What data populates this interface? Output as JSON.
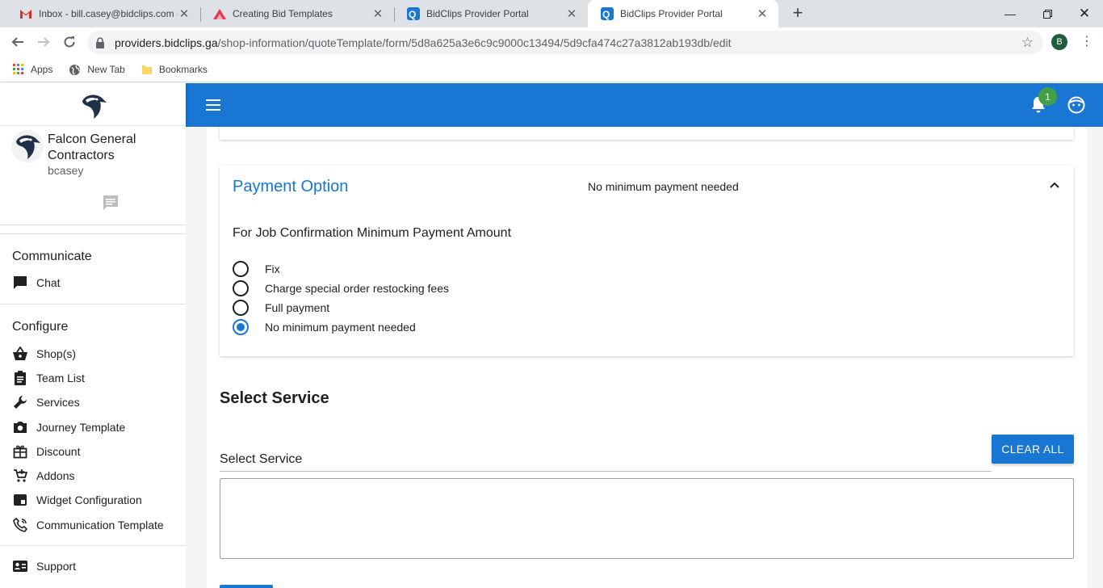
{
  "browser": {
    "tabs": [
      {
        "title": "Inbox - bill.casey@bidclips.com -",
        "icon": "gmail-icon",
        "active": false
      },
      {
        "title": "Creating Bid Templates",
        "icon": "mountain-icon",
        "active": false
      },
      {
        "title": "BidClips Provider Portal",
        "icon": "bidclips-icon",
        "active": false
      },
      {
        "title": "BidClips Provider Portal",
        "icon": "bidclips-icon",
        "active": true
      }
    ],
    "url_host": "providers.bidclips.ga",
    "url_path": "/shop-information/quoteTemplate/form/5d8a625a3e6c9c9000c13494/5d9cfa474c27a3812ab193db/edit",
    "profile_initial": "B",
    "bookmarks": [
      {
        "label": "Apps",
        "icon": "apps-grid-icon"
      },
      {
        "label": "New Tab",
        "icon": "globe-icon"
      },
      {
        "label": "Bookmarks",
        "icon": "folder-icon"
      }
    ]
  },
  "header": {
    "notification_count": "1",
    "color": "#1976d2"
  },
  "sidebar": {
    "org_name": "Falcon General Contractors",
    "username": "bcasey",
    "sections": [
      {
        "title": "Communicate",
        "items": [
          {
            "label": "Chat",
            "icon": "chat-icon"
          }
        ]
      },
      {
        "title": "Configure",
        "items": [
          {
            "label": "Shop(s)",
            "icon": "basket-icon"
          },
          {
            "label": "Team List",
            "icon": "clipboard-icon"
          },
          {
            "label": "Services",
            "icon": "wrench-icon"
          },
          {
            "label": "Journey Template",
            "icon": "camera-icon"
          },
          {
            "label": "Discount",
            "icon": "gift-icon"
          },
          {
            "label": "Addons",
            "icon": "cart-plus-icon"
          },
          {
            "label": "Widget Configuration",
            "icon": "widget-icon"
          },
          {
            "label": "Communication Template",
            "icon": "phone-icon"
          }
        ]
      }
    ],
    "support": {
      "label": "Support",
      "icon": "contact-card-icon"
    }
  },
  "payment_option": {
    "title": "Payment Option",
    "summary": "No minimum payment needed",
    "question": "For Job Confirmation Minimum Payment Amount",
    "options": [
      {
        "label": "Fix",
        "selected": false
      },
      {
        "label": "Charge special order restocking fees",
        "selected": false
      },
      {
        "label": "Full payment",
        "selected": false
      },
      {
        "label": "No minimum payment needed",
        "selected": true
      }
    ]
  },
  "select_service": {
    "title": "Select Service",
    "field_label": "Select Service",
    "clear_label": "CLEAR ALL"
  }
}
